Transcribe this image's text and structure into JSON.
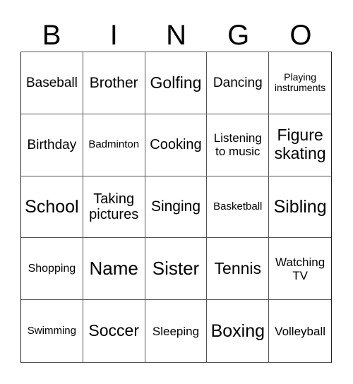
{
  "header": {
    "letters": [
      "B",
      "I",
      "N",
      "G",
      "O"
    ]
  },
  "cells": [
    "Baseball",
    "Brother",
    "Golfing",
    "Dancing",
    "Playing instruments",
    "Birthday",
    "Badminton",
    "Cooking",
    "Listening to music",
    "Figure skating",
    "School",
    "Taking pictures",
    "Singing",
    "Basketball",
    "Sibling",
    "Shopping",
    "Name",
    "Sister",
    "Tennis",
    "Watching TV",
    "Swimming",
    "Soccer",
    "Sleeping",
    "Boxing",
    "Volleyball"
  ]
}
